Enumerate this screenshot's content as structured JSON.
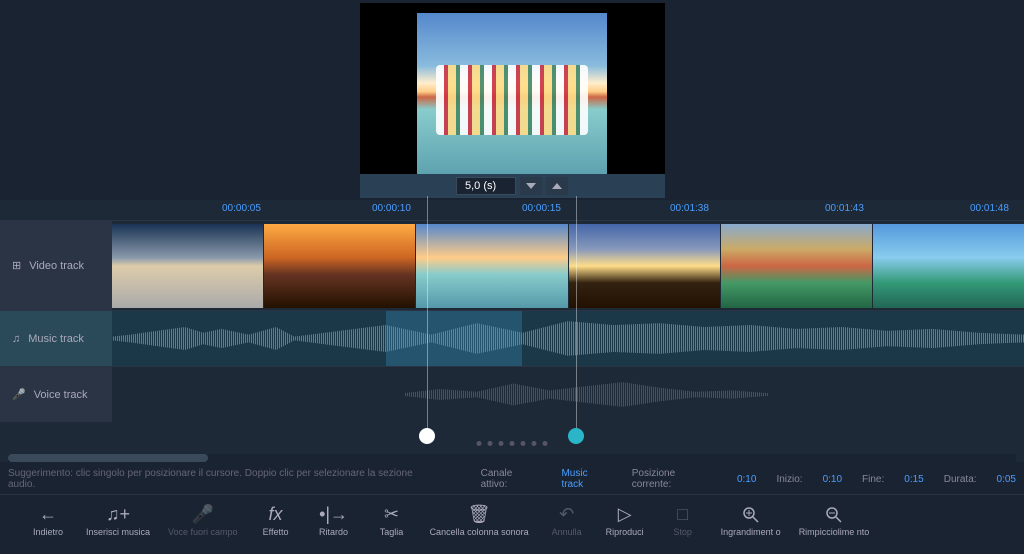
{
  "preview": {
    "duration_value": "5,0 (s)"
  },
  "ruler": {
    "ticks": [
      "00:00:05",
      "00:00:10",
      "00:00:15",
      "00:01:38",
      "00:01:43",
      "00:01:48"
    ]
  },
  "tracks": {
    "video_label": "Video track",
    "music_label": "Music track",
    "voice_label": "Voice track"
  },
  "hint": "Suggerimento: clic singolo per posizionare il cursore. Doppio clic per selezionare la sezione audio.",
  "status": {
    "canale_label": "Canale attivo:",
    "canale_value": "Music track",
    "posizione_label": "Posizione corrente:",
    "posizione_value": "0:10",
    "inizio_label": "Inizio:",
    "inizio_value": "0:10",
    "fine_label": "Fine:",
    "fine_value": "0:15",
    "durata_label": "Durata:",
    "durata_value": "0:05"
  },
  "toolbar": {
    "indietro": "Indietro",
    "inserisci": "Inserisci musica",
    "voce": "Voce fuori campo",
    "effetto": "Effetto",
    "ritardo": "Ritardo",
    "taglia": "Taglia",
    "cancella": "Cancella colonna sonora",
    "annulla": "Annulla",
    "riproduci": "Riproduci",
    "stop": "Stop",
    "zoom_in": "Ingrandiment o",
    "zoom_out": "Rimpicciolime nto"
  }
}
